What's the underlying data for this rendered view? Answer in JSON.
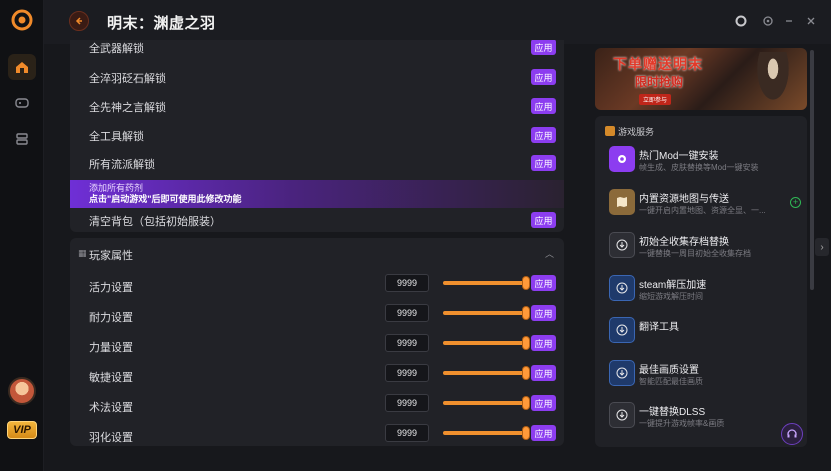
{
  "app": {
    "title": "明末：渊虚之羽",
    "back_icon": "back-arrow-icon",
    "accent": "#8c3df0",
    "orange": "#f0902e"
  },
  "sidebar": {
    "vip_label": "VIP",
    "items": [
      {
        "icon": "home-icon",
        "active": true
      },
      {
        "icon": "gamepad-icon",
        "active": false
      },
      {
        "icon": "storage-icon",
        "active": false
      }
    ]
  },
  "unlocks": {
    "apply_label": "应用",
    "rows": [
      {
        "label": "全武器解锁"
      },
      {
        "label": "全淬羽砭石解锁"
      },
      {
        "label": "全先神之言解锁"
      },
      {
        "label": "全工具解锁"
      },
      {
        "label": "所有流派解锁"
      }
    ],
    "tooltip": {
      "line1": "添加所有药剂",
      "line2": "点击\"启动游戏\"后即可使用此修改功能"
    },
    "last_row": {
      "label": "清空背包（包括初始服装）"
    }
  },
  "attributes": {
    "title": "玩家属性",
    "apply_label": "应用",
    "rows": [
      {
        "label": "活力设置",
        "value": "9999",
        "level": 1.0
      },
      {
        "label": "耐力设置",
        "value": "9999",
        "level": 1.0
      },
      {
        "label": "力量设置",
        "value": "9999",
        "level": 1.0
      },
      {
        "label": "敏捷设置",
        "value": "9999",
        "level": 1.0
      },
      {
        "label": "术法设置",
        "value": "9999",
        "level": 1.0
      },
      {
        "label": "羽化设置",
        "value": "9999",
        "level": 1.0
      }
    ]
  },
  "banner": {
    "line1": "下单赠送明末",
    "line2": "限时抢购",
    "cta": "立即参与"
  },
  "services": {
    "header": "游戏服务",
    "items": [
      {
        "name": "热门Mod一键安装",
        "desc": "帧生成、皮肤替换等Mod一键安装",
        "icon": "mod-icon"
      },
      {
        "name": "内置资源地图与传送",
        "desc": "一键开启内置地图、资源全显、一...",
        "icon": "map-icon",
        "plus": true
      },
      {
        "name": "初始全收集存档替换",
        "desc": "一键替换一周目初始全收集存档",
        "icon": "download-icon"
      },
      {
        "name": "steam解压加速",
        "desc": "缩短游戏解压时间",
        "icon": "download-icon"
      },
      {
        "name": "翻译工具",
        "desc": "",
        "icon": "download-icon"
      },
      {
        "name": "最佳画质设置",
        "desc": "智能匹配最佳画质",
        "icon": "download-icon"
      },
      {
        "name": "一键替换DLSS",
        "desc": "一键提升游戏帧率&画质",
        "icon": "download-icon"
      }
    ]
  }
}
